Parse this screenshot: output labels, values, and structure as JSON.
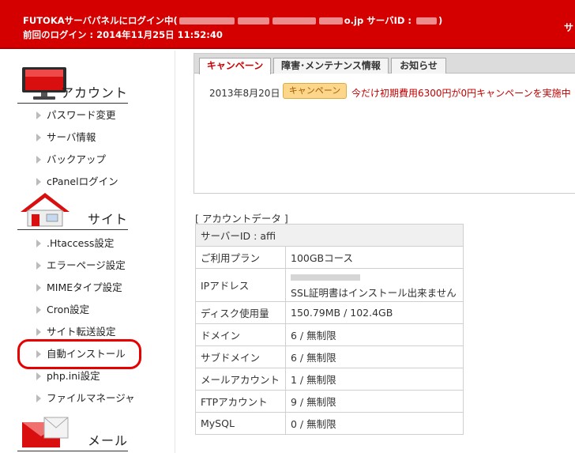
{
  "header": {
    "line1_prefix": "FUTOKAサーバパネルにログイン中(",
    "line1_suffix": "o.jp サーバID : ",
    "line1_end": ")",
    "line2": "前回のログイン : 2014年11月25日 11:52:40",
    "right_text": "サ",
    "bg_color": "#d40000"
  },
  "sidebar": {
    "sections": [
      {
        "title": "アカウント",
        "icon": "monitor-icon"
      },
      {
        "title": "サイト",
        "icon": "house-icon"
      },
      {
        "title": "メール",
        "icon": "envelope-icon"
      }
    ],
    "account_items": [
      "パスワード変更",
      "サーバ情報",
      "バックアップ",
      "cPanelログイン"
    ],
    "site_items": [
      ".Htaccess設定",
      "エラーページ設定",
      "MIMEタイプ設定",
      "Cron設定",
      "サイト転送設定",
      "自動インストール",
      "php.ini設定",
      "ファイルマネージャ"
    ]
  },
  "tabs": [
    "キャンペーン",
    "障害･メンテナンス情報",
    "お知らせ"
  ],
  "news": {
    "date": "2013年8月20日",
    "badge": "キャンペーン",
    "text": "今だけ初期費用6300円が0円キャンペーンを実施中"
  },
  "account": {
    "label": "[ アカウントデータ ]",
    "server_id": "サーバーID : affi",
    "rows": [
      {
        "key": "ご利用プラン",
        "value": "100GBコース"
      },
      {
        "key": "IPアドレス",
        "value": "SSL証明書はインストール出来ません"
      },
      {
        "key": "ディスク使用量",
        "value": "150.79MB / 102.4GB"
      },
      {
        "key": "ドメイン",
        "value": "6 / 無制限"
      },
      {
        "key": "サブドメイン",
        "value": "6 / 無制限"
      },
      {
        "key": "メールアカウント",
        "value": "1 / 無制限"
      },
      {
        "key": "FTPアカウント",
        "value": "9 / 無制限"
      },
      {
        "key": "MySQL",
        "value": "0 / 無制限"
      }
    ]
  }
}
